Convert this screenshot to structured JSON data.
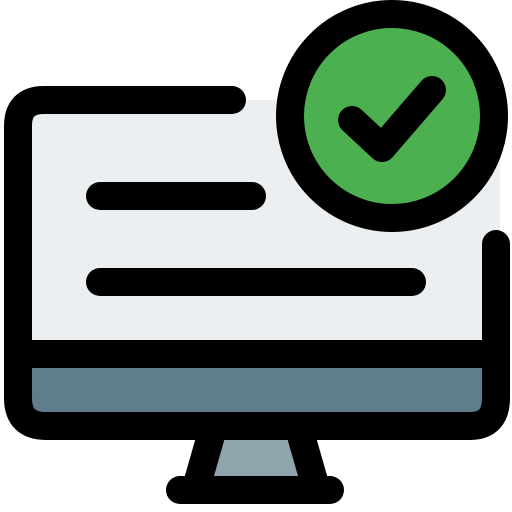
{
  "icon": {
    "name": "monitor-check-icon",
    "colors": {
      "outline": "#000000",
      "screen": "#eceff1",
      "bezel": "#607d8b",
      "stand": "#90a4ae",
      "check_badge": "#4caf50",
      "background": "#ffffff"
    }
  }
}
